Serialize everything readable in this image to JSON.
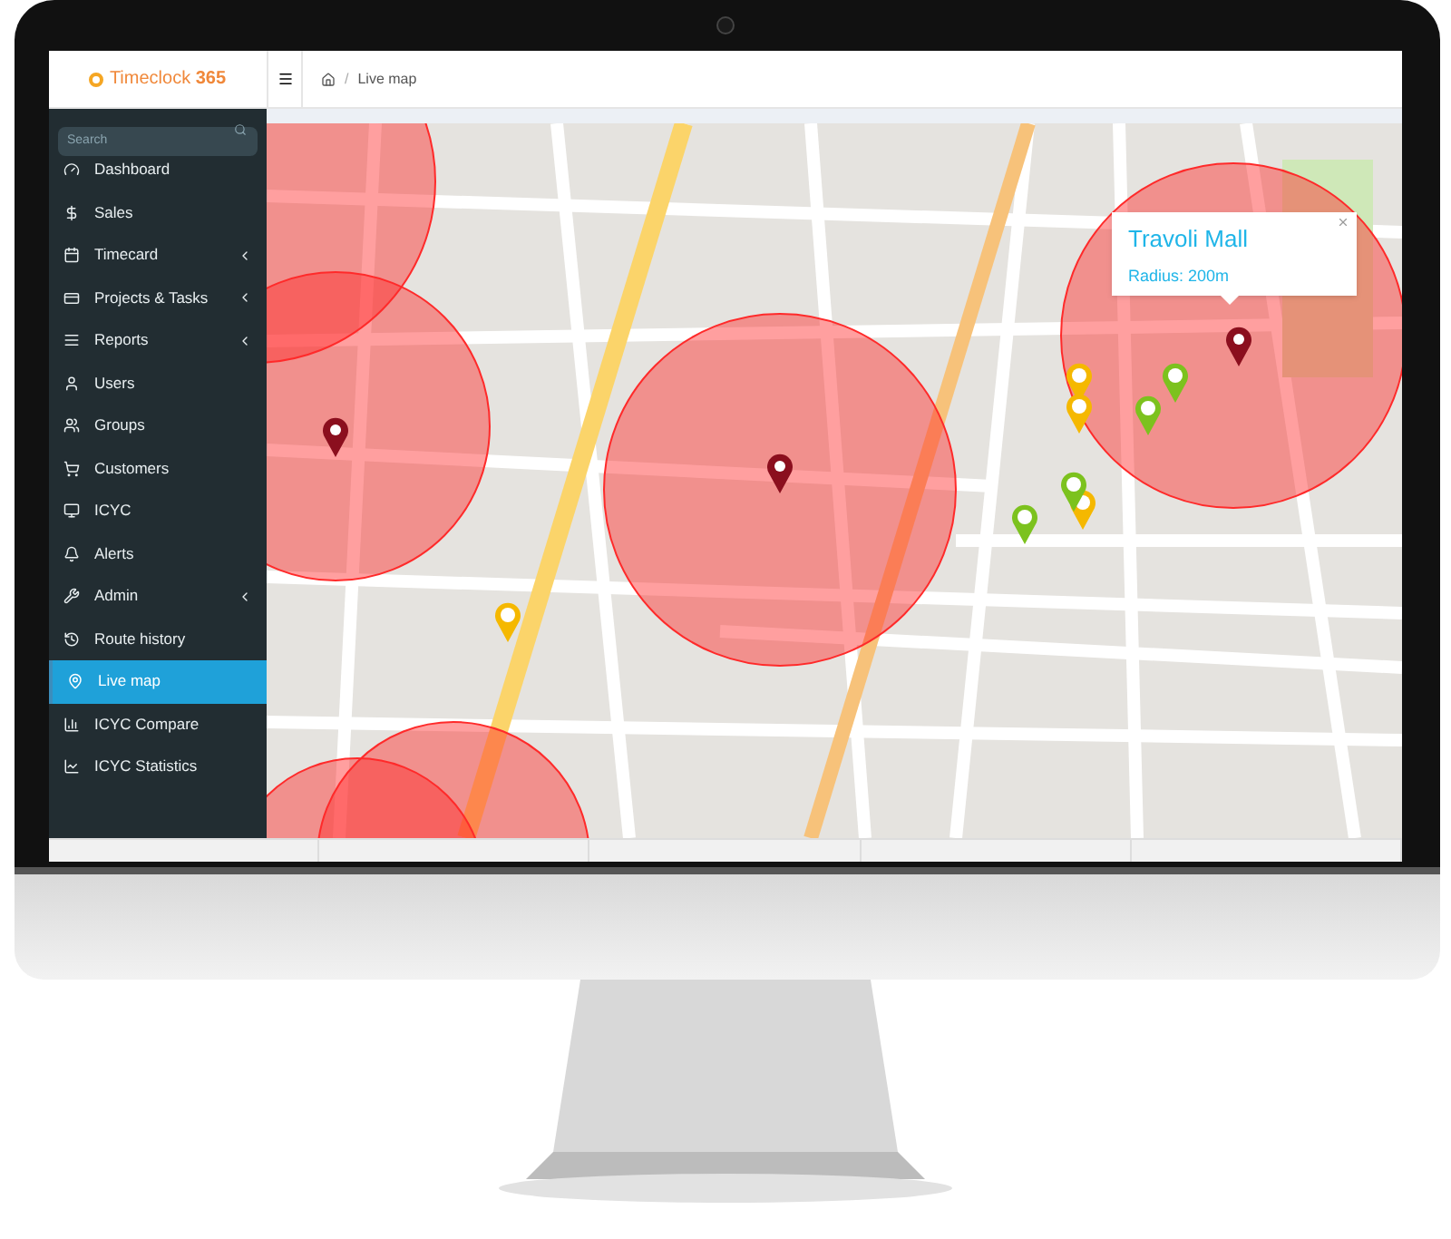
{
  "logo": {
    "name": "Timeclock",
    "suffix": "365"
  },
  "breadcrumb": {
    "separator": "/",
    "current": "Live map"
  },
  "search": {
    "placeholder": "Search"
  },
  "sidebar": {
    "items": [
      {
        "label": "Dashboard",
        "expandable": false,
        "selected": false
      },
      {
        "label": "Sales",
        "expandable": false,
        "selected": false
      },
      {
        "label": "Timecard",
        "expandable": true,
        "selected": false
      },
      {
        "label": "Projects & Tasks",
        "expandable": true,
        "selected": false
      },
      {
        "label": "Reports",
        "expandable": true,
        "selected": false
      },
      {
        "label": "Users",
        "expandable": false,
        "selected": false
      },
      {
        "label": "Groups",
        "expandable": false,
        "selected": false
      },
      {
        "label": "Customers",
        "expandable": false,
        "selected": false
      },
      {
        "label": "ICYC",
        "expandable": false,
        "selected": false
      },
      {
        "label": "Alerts",
        "expandable": false,
        "selected": false
      },
      {
        "label": "Admin",
        "expandable": true,
        "selected": false
      },
      {
        "label": "Route history",
        "expandable": false,
        "selected": false
      },
      {
        "label": "Live map",
        "expandable": false,
        "selected": true
      },
      {
        "label": "ICYC Compare",
        "expandable": false,
        "selected": false
      },
      {
        "label": "ICYC Statistics",
        "expandable": false,
        "selected": false
      }
    ]
  },
  "map": {
    "popup": {
      "title": "Travoli Mall",
      "radius": "Radius: 200m"
    },
    "pins": [
      {
        "kind": "person",
        "color": "#8b0f1e"
      },
      {
        "kind": "person",
        "color": "#8b0f1e"
      },
      {
        "kind": "person",
        "color": "#8b0f1e"
      },
      {
        "kind": "plain",
        "color": "#f5b800"
      },
      {
        "kind": "plain",
        "color": "#f5b800"
      },
      {
        "kind": "plain",
        "color": "#f5b800"
      },
      {
        "kind": "plain",
        "color": "#f5b800"
      },
      {
        "kind": "plain",
        "color": "#7cc21e"
      },
      {
        "kind": "plain",
        "color": "#7cc21e"
      },
      {
        "kind": "plain",
        "color": "#7cc21e"
      },
      {
        "kind": "plain",
        "color": "#7cc21e"
      }
    ]
  }
}
